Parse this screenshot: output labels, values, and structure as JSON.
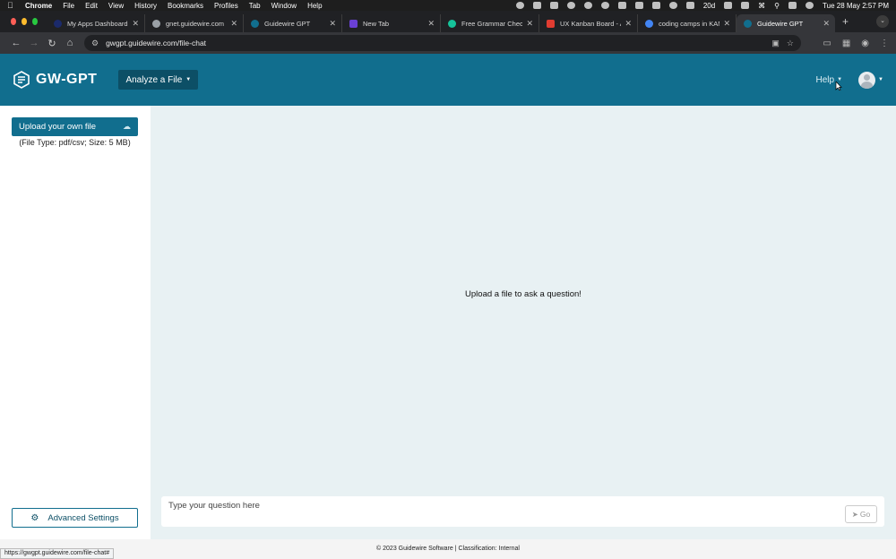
{
  "os_menubar": {
    "app": "Chrome",
    "menus": [
      "File",
      "Edit",
      "View",
      "History",
      "Bookmarks",
      "Profiles",
      "Tab",
      "Window",
      "Help"
    ],
    "status_text": "20d",
    "datetime": "Tue 28 May  2:57 PM"
  },
  "tabs": [
    {
      "title": "My Apps Dashboard |",
      "color": "#1b2a6b"
    },
    {
      "title": "gnet.guidewire.com",
      "color": "#9aa0a6"
    },
    {
      "title": "Guidewire GPT",
      "color": "#116e8e"
    },
    {
      "title": "New Tab",
      "color": "#6a40d4"
    },
    {
      "title": "Free Grammar Checker",
      "color": "#15c39a"
    },
    {
      "title": "UX Kanban Board - Ag",
      "color": "#e03c31"
    },
    {
      "title": "coding camps in KANS",
      "color": "#4285f4"
    },
    {
      "title": "Guidewire GPT",
      "color": "#116e8e",
      "active": true
    }
  ],
  "address_bar": {
    "url": "gwgpt.guidewire.com/file-chat"
  },
  "header": {
    "logo_text": "GW-GPT",
    "analyze_label": "Analyze a File",
    "help_label": "Help"
  },
  "sidebar": {
    "upload_label": "Upload your own file",
    "file_type_note": "(File Type: pdf/csv; Size: 5 MB)",
    "advanced_settings_label": "Advanced Settings"
  },
  "main": {
    "empty_message": "Upload a file to ask a question!",
    "question_placeholder": "Type your question here",
    "go_label": "Go"
  },
  "footer": {
    "text": "© 2023 Guidewire Software | Classification: Internal"
  },
  "status_bar": {
    "url": "https://gwgpt.guidewire.com/file-chat#"
  },
  "colors": {
    "brand": "#116e8e",
    "brand_dark": "#0c4f66",
    "page_bg": "#e8f1f3"
  }
}
